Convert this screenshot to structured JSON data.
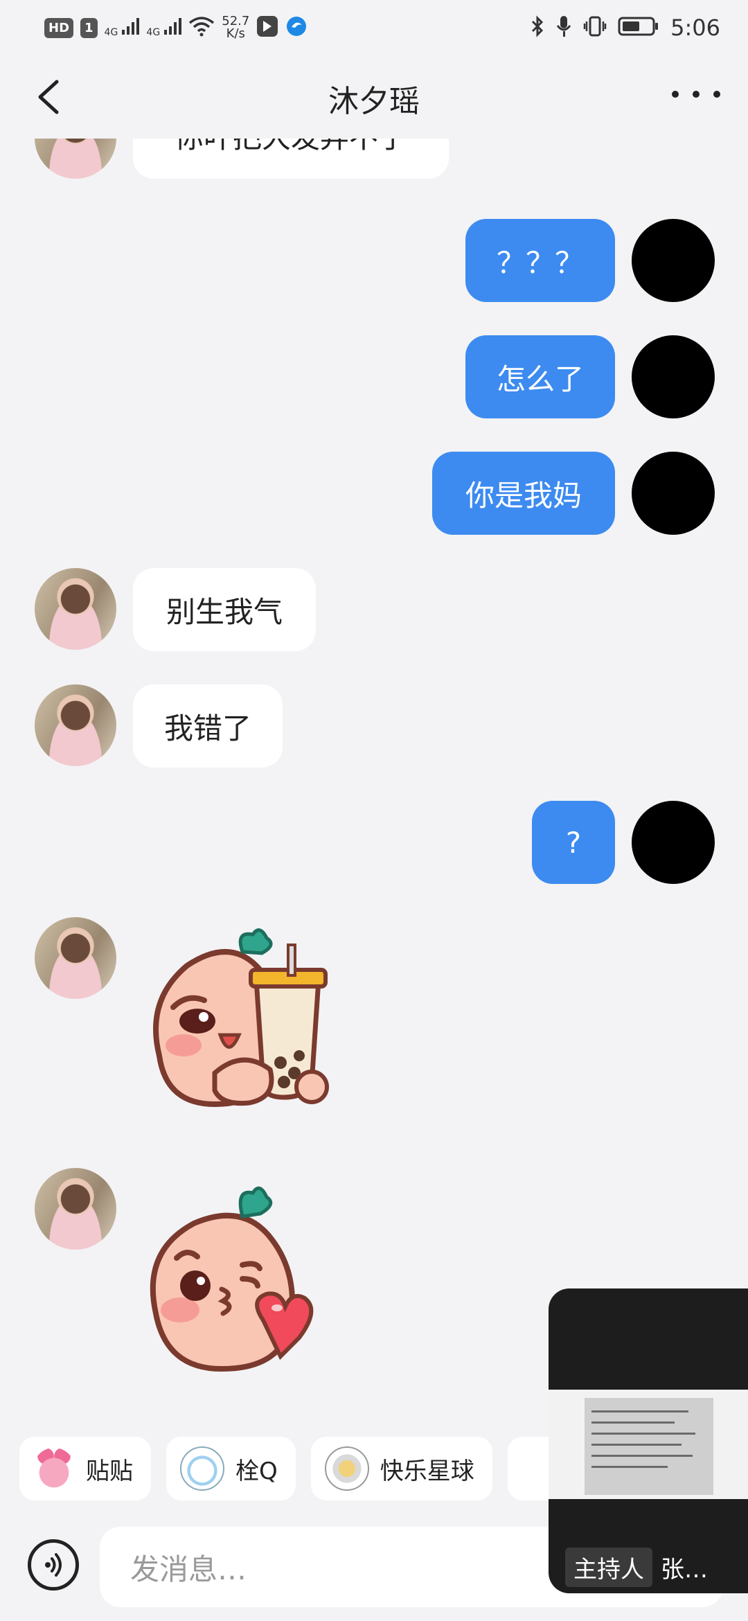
{
  "status_bar": {
    "hd_badge": "HD",
    "sim_badge": "1",
    "net1": "4G",
    "net2": "4G",
    "speed_value": "52.7",
    "speed_unit": "K/s",
    "time": "5:06"
  },
  "header": {
    "title": "沐夕瑶"
  },
  "messages": [
    {
      "from": "her",
      "text": "你叶把大发弃不了",
      "partial": true
    },
    {
      "from": "me",
      "text": "？？？"
    },
    {
      "from": "me",
      "text": "怎么了"
    },
    {
      "from": "me",
      "text": "你是我妈"
    },
    {
      "from": "her",
      "text": "别生我气"
    },
    {
      "from": "her",
      "text": "我错了"
    },
    {
      "from": "me",
      "text": "?"
    },
    {
      "from": "her",
      "type": "sticker",
      "sticker": "peach-bubble-tea-sticker"
    },
    {
      "from": "her",
      "type": "sticker",
      "sticker": "peach-kiss-heart-sticker"
    }
  ],
  "quick_chips": [
    {
      "label": "贴贴",
      "icon": "pink-bunny-icon"
    },
    {
      "label": "栓Q",
      "icon": "cow-icon"
    },
    {
      "label": "快乐星球",
      "icon": "astronaut-icon"
    }
  ],
  "composer": {
    "placeholder": "发消息…"
  },
  "floating_window": {
    "host_tag": "主持人",
    "name": "张…"
  },
  "colors": {
    "outgoing_bubble": "#3d8bf0",
    "incoming_bubble": "#ffffff",
    "background": "#f3f3f5"
  }
}
